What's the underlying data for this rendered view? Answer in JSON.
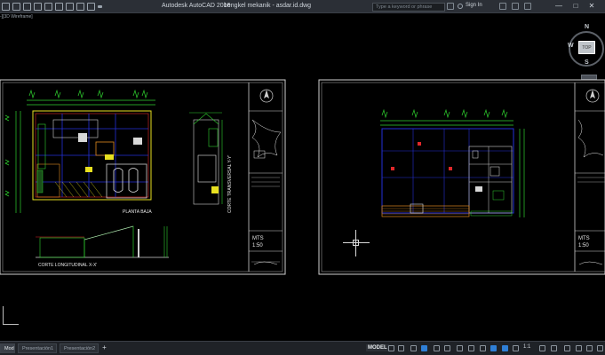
{
  "window": {
    "app_title": "Autodesk AutoCAD 2016",
    "file_title": "bengkel mekanik - asdar.id.dwg",
    "search_placeholder": "Type a keyword or phrase",
    "sign_in": "Sign In",
    "minimize": "—",
    "maximize": "□",
    "close": "✕"
  },
  "viewport_control": "-][3D Wireframe]",
  "viewcube": {
    "face": "TOP",
    "north": "N",
    "south": "S",
    "west": "W"
  },
  "sheets": [
    {
      "plan_label": "PLANTA BAJA",
      "section_long": "CORTE LONGITUDINAL X-X'",
      "section_trans": "CORTE TRANSVERSAL Y-Y'",
      "title_block_code": "MTS",
      "title_block_scale": "1:50"
    },
    {
      "title_block_code": "MTS",
      "title_block_scale": "1:50"
    }
  ],
  "tabs": [
    {
      "label": "Model",
      "active": true
    },
    {
      "label": "Presentación1",
      "active": false
    },
    {
      "label": "Presentación2",
      "active": false
    }
  ],
  "tab_add": "+",
  "status": {
    "model": "MODEL",
    "scale": "1:1"
  },
  "colors": {
    "background": "#000000",
    "green": "#2fd12f",
    "yellow": "#e8e020",
    "red": "#e0282a",
    "blue": "#2530d8",
    "orange": "#e08a20"
  }
}
